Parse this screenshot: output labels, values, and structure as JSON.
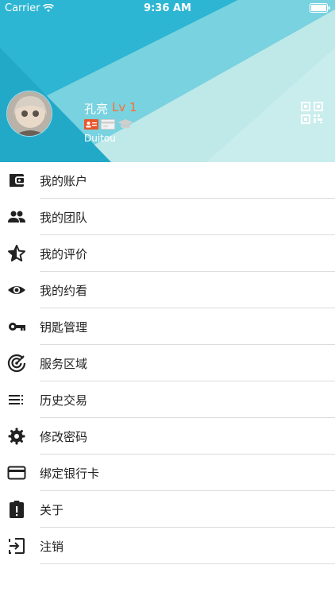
{
  "status_bar": {
    "carrier": "Carrier",
    "time": "9:36 AM"
  },
  "profile": {
    "name": "孔亮",
    "level": "Lv 1",
    "username": "Duitou"
  },
  "menu": {
    "items": [
      {
        "label": "我的账户",
        "icon": "wallet-icon"
      },
      {
        "label": "我的团队",
        "icon": "people-icon"
      },
      {
        "label": "我的评价",
        "icon": "star-half-icon"
      },
      {
        "label": "我的约看",
        "icon": "eye-icon"
      },
      {
        "label": "钥匙管理",
        "icon": "key-icon"
      },
      {
        "label": "服务区域",
        "icon": "radar-icon"
      },
      {
        "label": "历史交易",
        "icon": "list-icon"
      },
      {
        "label": "修改密码",
        "icon": "gear-icon"
      },
      {
        "label": "绑定银行卡",
        "icon": "credit-card-icon"
      },
      {
        "label": "关于",
        "icon": "clipboard-alert-icon"
      },
      {
        "label": "注销",
        "icon": "logout-icon"
      }
    ]
  },
  "colors": {
    "header_cyan": "#28b9d6",
    "header_mint": "#bfe9e9",
    "level_orange": "#ff6d2d",
    "icon_dark": "#212121"
  }
}
